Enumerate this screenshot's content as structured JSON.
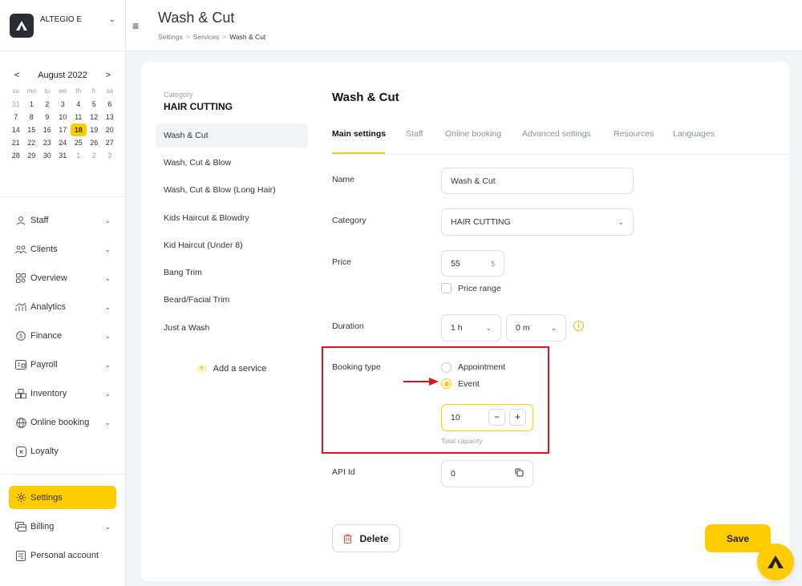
{
  "brand": {
    "name": "ALTEGIO E"
  },
  "calendar": {
    "month_label": "August 2022",
    "prev": "<",
    "next": ">",
    "weekdays": [
      "su",
      "mo",
      "tu",
      "we",
      "th",
      "fr",
      "sa"
    ],
    "weeks": [
      [
        "31",
        "1",
        "2",
        "3",
        "4",
        "5",
        "6"
      ],
      [
        "7",
        "8",
        "9",
        "10",
        "11",
        "12",
        "13"
      ],
      [
        "14",
        "15",
        "16",
        "17",
        "18",
        "19",
        "20"
      ],
      [
        "21",
        "22",
        "23",
        "24",
        "25",
        "26",
        "27"
      ],
      [
        "28",
        "29",
        "30",
        "31",
        "1",
        "2",
        "3"
      ]
    ],
    "selected_day": "18"
  },
  "nav": {
    "staff": "Staff",
    "clients": "Clients",
    "overview": "Overview",
    "analytics": "Analytics",
    "finance": "Finance",
    "payroll": "Payroll",
    "inventory": "Inventory",
    "online_booking": "Online booking",
    "loyalty": "Loyalty",
    "settings": "Settings",
    "billing": "Billing",
    "personal_account": "Personal account"
  },
  "header": {
    "title": "Wash & Cut",
    "breadcrumb": [
      "Settings",
      "Services",
      "Wash & Cut"
    ]
  },
  "services_panel": {
    "category_caption": "Category",
    "category_name": "HAIR CUTTING",
    "items": [
      "Wash & Cut",
      "Wash, Cut & Blow",
      "Wash, Cut & Blow (Long Hair)",
      "Kids Haircut & Blowdry",
      "Kid Haircut (Under 8)",
      "Bang Trim",
      "Beard/Facial Trim",
      "Just a Wash"
    ],
    "add_label": "Add a service"
  },
  "detail": {
    "title": "Wash & Cut",
    "tabs": [
      "Main settings",
      "Staff",
      "Online booking",
      "Advanced settings",
      "Resources",
      "Languages"
    ],
    "name_label": "Name",
    "name_value": "Wash & Cut",
    "category_label": "Category",
    "category_value": "HAIR CUTTING",
    "price_label": "Price",
    "price_value": "55",
    "currency": "$",
    "price_range_label": "Price range",
    "duration_label": "Duration",
    "duration_hours": "1 h",
    "duration_minutes": "0 m",
    "booking_type_label": "Booking type",
    "booking_options": [
      "Appointment",
      "Event"
    ],
    "booking_selected": "Event",
    "capacity_value": "10",
    "capacity_hint": "Total capacity",
    "api_label": "API Id",
    "api_value": "0",
    "delete_label": "Delete",
    "save_label": "Save"
  },
  "colors": {
    "accent": "#ffcc00",
    "highlight": "#e3121b",
    "delete_icon": "#e8533f"
  }
}
